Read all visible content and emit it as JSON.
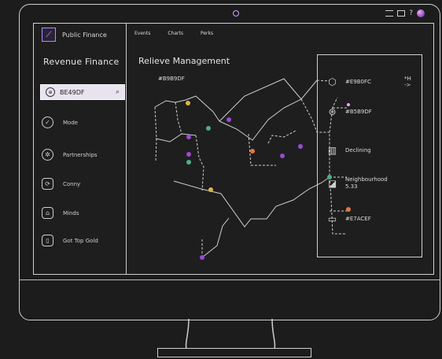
{
  "device": {
    "status_icons": [
      "menu-lines-icon",
      "window-icon",
      "question-icon",
      "avatar"
    ]
  },
  "brand": {
    "name": "Public Finance"
  },
  "sidebar": {
    "title": "Revenue Finance",
    "search": {
      "value": "BE49DF"
    },
    "items": [
      {
        "label": "Mode",
        "icon": "check-circle-icon"
      },
      {
        "label": "Partnerships",
        "icon": "network-icon"
      },
      {
        "label": "Conny",
        "icon": "loop-icon"
      },
      {
        "label": "Minds",
        "icon": "home-graph-icon"
      },
      {
        "label": "Got Top Gold",
        "icon": "document-icon"
      }
    ]
  },
  "tabs": [
    {
      "label": "Events"
    },
    {
      "label": "Charts"
    },
    {
      "label": "Perks"
    }
  ],
  "main": {
    "title": "Relieve Management",
    "node_label": "#B9B9DF"
  },
  "right_panel": {
    "items": [
      {
        "label": "#E9B0FC",
        "count": "*H ->",
        "icon": "cube-icon"
      },
      {
        "label": "#B5B9DF",
        "icon": "globe-icon"
      },
      {
        "label": "Declining",
        "icon": "bar-chart-icon"
      },
      {
        "label": "Neighbourhood",
        "sub": "5.33",
        "icon": "growth-chart-icon"
      },
      {
        "label": "#E7ACEF",
        "icon": "battery-icon"
      }
    ]
  },
  "colors": {
    "accent": "#b48bff",
    "node_purple": "#9a4bd1",
    "node_green": "#4fae83",
    "node_orange": "#e07a3a",
    "node_yellow": "#e2b24a",
    "line": "#cfcfcf"
  }
}
